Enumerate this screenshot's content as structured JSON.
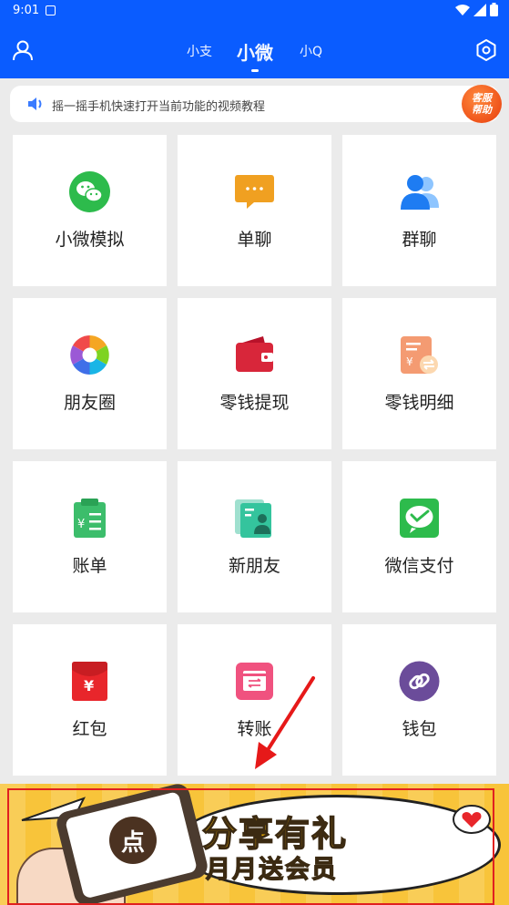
{
  "status_bar": {
    "time": "9:01"
  },
  "header": {
    "tabs": [
      {
        "label": "小支"
      },
      {
        "label": "小微"
      },
      {
        "label": "小Q"
      }
    ],
    "active_tab_index": 1
  },
  "tip": {
    "text": "摇一摇手机快速打开当前功能的视频教程",
    "badge_line1": "客服",
    "badge_line2": "帮助"
  },
  "grid": {
    "items": [
      {
        "label": "小微模拟",
        "icon": "wechat-icon"
      },
      {
        "label": "单聊",
        "icon": "chat-bubble-icon"
      },
      {
        "label": "群聊",
        "icon": "group-icon"
      },
      {
        "label": "朋友圈",
        "icon": "moments-icon"
      },
      {
        "label": "零钱提现",
        "icon": "wallet-icon"
      },
      {
        "label": "零钱明细",
        "icon": "transaction-detail-icon"
      },
      {
        "label": "账单",
        "icon": "bill-icon"
      },
      {
        "label": "新朋友",
        "icon": "new-friend-icon"
      },
      {
        "label": "微信支付",
        "icon": "wechat-pay-icon"
      },
      {
        "label": "红包",
        "icon": "red-packet-icon"
      },
      {
        "label": "转账",
        "icon": "transfer-icon"
      },
      {
        "label": "钱包",
        "icon": "wallet-link-icon"
      }
    ]
  },
  "banner": {
    "title": "分享有礼",
    "subtitle": "月月送会员",
    "tap_char": "点"
  },
  "colors": {
    "primary": "#0a5cff",
    "background": "#ebebeb",
    "banner": "#f8c43a"
  }
}
